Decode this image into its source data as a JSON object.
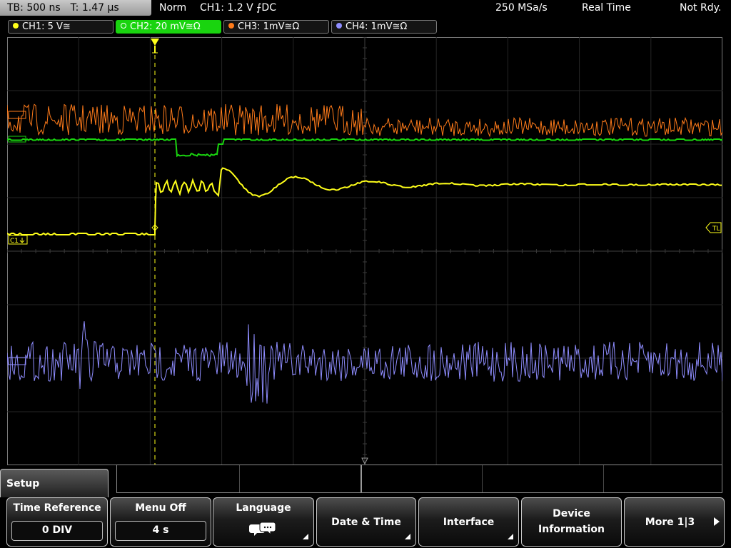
{
  "status": {
    "timebase": "TB: 500 ns",
    "trigger_time": "T: 1.47 µs",
    "mode": "Norm",
    "trigger_info": "CH1: 1.2 V ⨍DC",
    "sample_rate": "250 MSa/s",
    "acq_mode": "Real Time",
    "ready_state": "Not Rdy."
  },
  "channels": [
    {
      "label": "CH1: 5 V≅",
      "color": "#ffff1a",
      "active": false
    },
    {
      "label": "CH2: 20 mV≅Ω",
      "color": "#19d40f",
      "active": true
    },
    {
      "label": "CH3: 1mV≅Ω",
      "color": "#ff7b1a",
      "active": false
    },
    {
      "label": "CH4: 1mV≅Ω",
      "color": "#8f8dff",
      "active": false
    }
  ],
  "markers": {
    "trigger_level": "TL",
    "ch1_ground": "C1"
  },
  "setup": {
    "title": "Setup"
  },
  "softkeys": [
    {
      "id": "time-reference",
      "label": "Time Reference",
      "value": "0 DIV"
    },
    {
      "id": "menu-off",
      "label": "Menu Off",
      "value": "4 s"
    },
    {
      "id": "language",
      "label": "Language"
    },
    {
      "id": "date-time",
      "label": "Date & Time"
    },
    {
      "id": "interface",
      "label": "Interface"
    },
    {
      "id": "device-information",
      "label_line1": "Device",
      "label_line2": "Information"
    },
    {
      "id": "more",
      "label": "More 1|3"
    }
  ]
}
